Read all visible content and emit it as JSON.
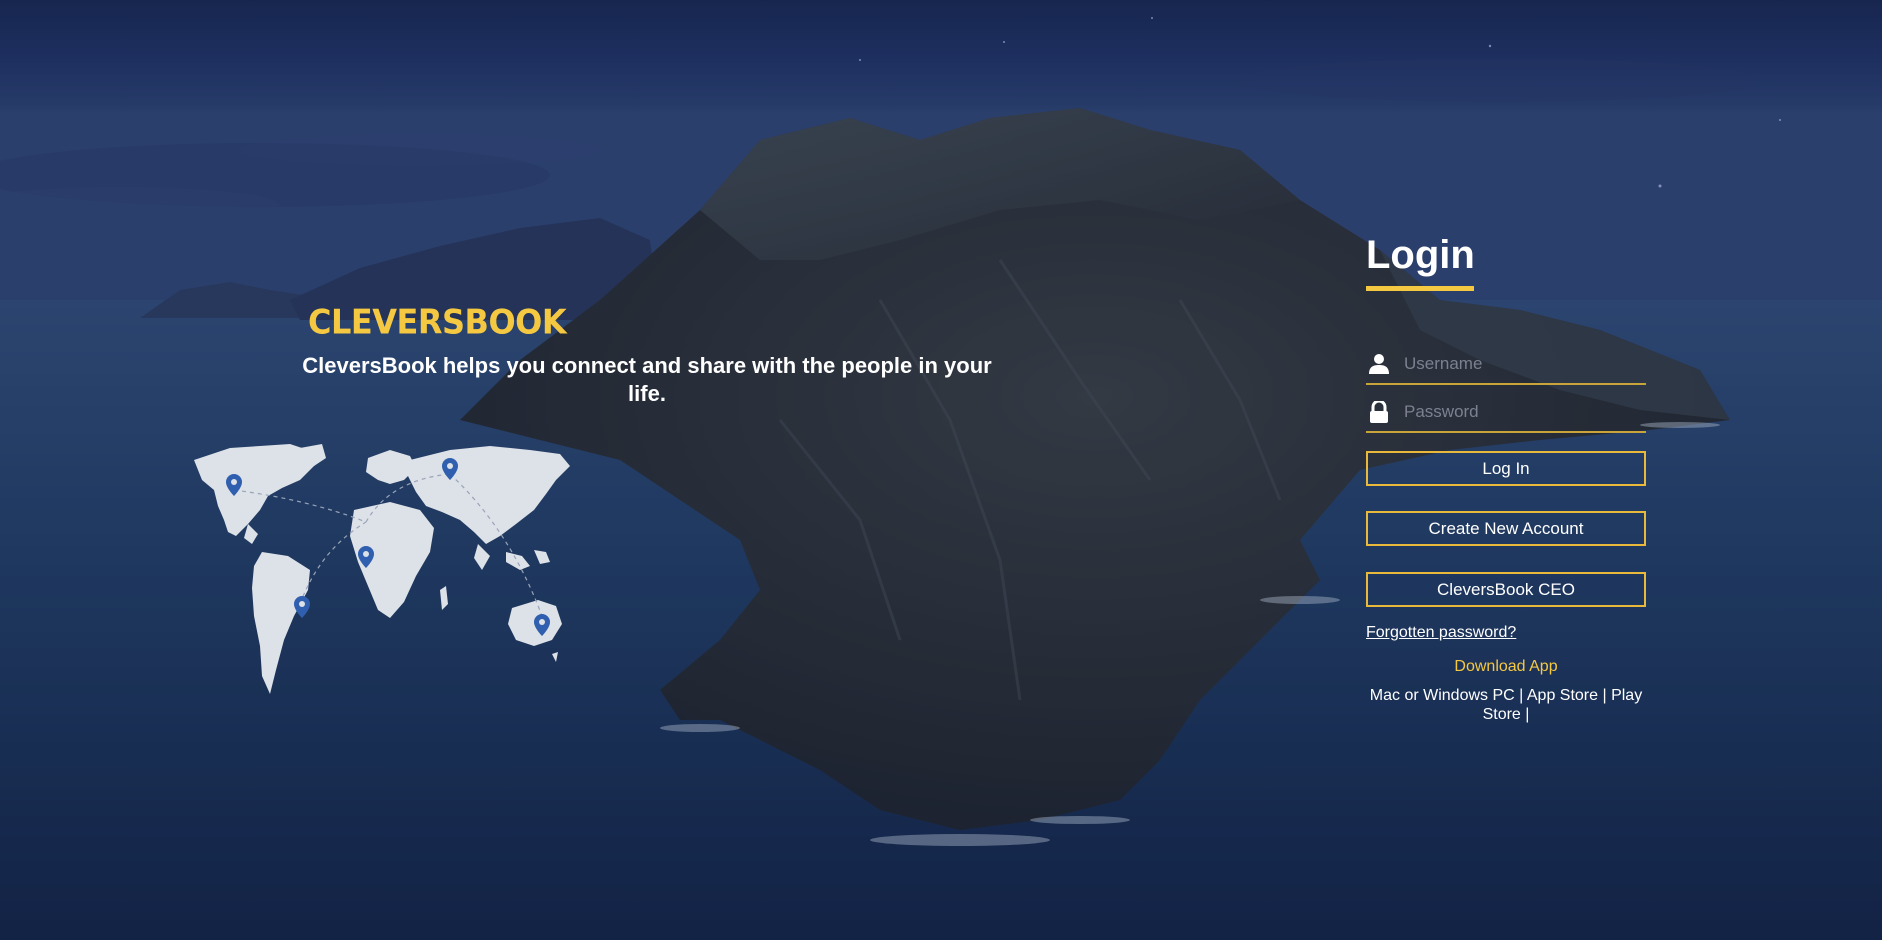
{
  "brand": {
    "name": "CLEVERSBOOK",
    "tagline": "CleversBook helps you connect and share with the people in your life.",
    "accent_color": "#f5c842"
  },
  "map": {
    "icon": "world-map-icon",
    "pin_icon": "location-pin-icon",
    "pin_color": "#2f5fae"
  },
  "login": {
    "title": "Login",
    "username_icon": "user-icon",
    "username_placeholder": "Username",
    "password_icon": "lock-icon",
    "password_placeholder": "Password",
    "login_button": "Log In",
    "create_account_button": "Create New Account",
    "ceo_button": "CleversBook CEO",
    "forgot_link": "Forgotten password?",
    "download_label": "Download App",
    "platforms": "Mac or Windows PC | App Store | Play Store |"
  }
}
